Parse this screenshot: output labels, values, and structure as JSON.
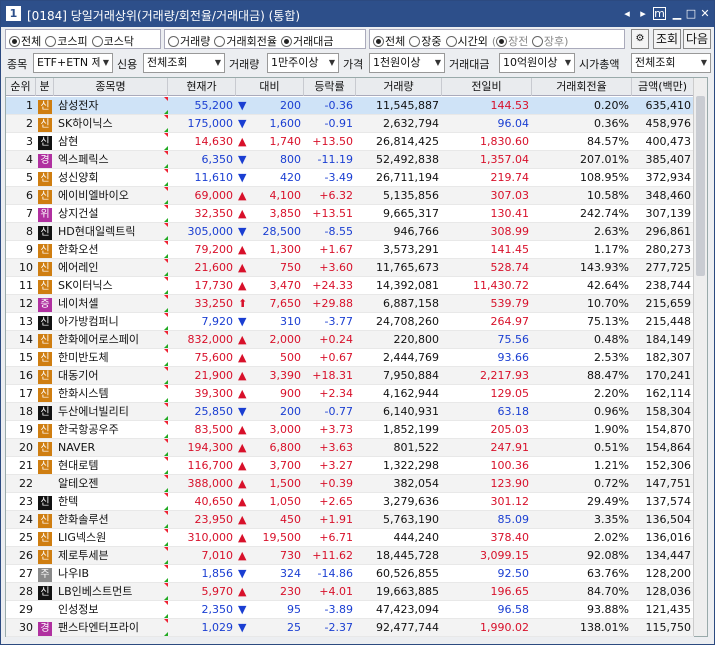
{
  "window": {
    "num": "1",
    "title": "[0184] 당일거래상위(거래량/회전율/거래대금) (통합)",
    "buttons": [
      "◂",
      "▸",
      "m",
      "▁",
      "□",
      "✕"
    ]
  },
  "bar1": {
    "market": [
      "전체",
      "코스피",
      "코스닥"
    ],
    "market_sel": 0,
    "sort": [
      "거래량",
      "거래회전율",
      "거래대금"
    ],
    "sort_sel": 2,
    "session": [
      "전체",
      "장중",
      "시간외"
    ],
    "session_sel": 0,
    "sub": [
      "장전",
      "장후"
    ],
    "sub_sel": 0,
    "btn_query": "조회",
    "btn_next": "다음"
  },
  "bar2": {
    "item_label": "종목",
    "item_val": "ETF+ETN 제",
    "credit_label": "신용",
    "credit_val": "전체조회",
    "vol_label": "거래량",
    "vol_val": "1만주이상",
    "price_label": "가격",
    "price_val": "1천원이상",
    "amt_label": "거래대금",
    "amt_val": "10억원이상",
    "cap_label": "시가총액",
    "cap_val": "전체조회"
  },
  "headers": [
    "순위",
    "분",
    "종목명",
    "현재가",
    "대비",
    "등락률",
    "거래량",
    "전일비",
    "거래회전율",
    "금액(백만)"
  ],
  "colors": {
    "badge_sin": "#cf7e11",
    "badge_gyeong": "#b030a0",
    "badge_ju": "#8a8a8a",
    "up": "#d8102a",
    "down": "#1a3ed2"
  },
  "rows": [
    {
      "rank": "1",
      "badge": "신",
      "name": "삼성전자",
      "price": "55,200",
      "arrow": "▼",
      "diff": "200",
      "rate": "-0.36",
      "volume": "11,545,887",
      "prev": "144.53",
      "turnover": "0.20%",
      "amount": "635,410",
      "dir": "dn",
      "sel": true
    },
    {
      "rank": "2",
      "badge": "신",
      "name": "SK하이닉스",
      "price": "175,000",
      "arrow": "▼",
      "diff": "1,600",
      "rate": "-0.91",
      "volume": "2,632,794",
      "prev": "96.04",
      "turnover": "0.36%",
      "amount": "458,976",
      "dir": "dn"
    },
    {
      "rank": "3",
      "badge": "신",
      "name": "삼현",
      "price": "14,630",
      "arrow": "▲",
      "diff": "1,740",
      "rate": "+13.50",
      "volume": "26,814,425",
      "prev": "1,830.60",
      "turnover": "84.57%",
      "amount": "400,473",
      "dir": "up"
    },
    {
      "rank": "4",
      "badge": "경",
      "name": "엑스페릭스",
      "price": "6,350",
      "arrow": "▼",
      "diff": "800",
      "rate": "-11.19",
      "volume": "52,492,838",
      "prev": "1,357.04",
      "turnover": "207.01%",
      "amount": "385,407",
      "dir": "dn"
    },
    {
      "rank": "5",
      "badge": "신",
      "name": "성신양회",
      "price": "11,610",
      "arrow": "▼",
      "diff": "420",
      "rate": "-3.49",
      "volume": "26,711,194",
      "prev": "219.74",
      "turnover": "108.95%",
      "amount": "372,934",
      "dir": "dn"
    },
    {
      "rank": "6",
      "badge": "신",
      "name": "에이비엘바이오",
      "price": "69,000",
      "arrow": "▲",
      "diff": "4,100",
      "rate": "+6.32",
      "volume": "5,135,856",
      "prev": "307.03",
      "turnover": "10.58%",
      "amount": "348,460",
      "dir": "up"
    },
    {
      "rank": "7",
      "badge": "위",
      "name": "상지건설",
      "price": "32,350",
      "arrow": "▲",
      "diff": "3,850",
      "rate": "+13.51",
      "volume": "9,665,317",
      "prev": "130.41",
      "turnover": "242.74%",
      "amount": "307,139",
      "dir": "up"
    },
    {
      "rank": "8",
      "badge": "신",
      "name": "HD현대일렉트릭",
      "price": "305,000",
      "arrow": "▼",
      "diff": "28,500",
      "rate": "-8.55",
      "volume": "946,766",
      "prev": "308.99",
      "turnover": "2.63%",
      "amount": "296,861",
      "dir": "dn"
    },
    {
      "rank": "9",
      "badge": "신",
      "name": "한화오션",
      "price": "79,200",
      "arrow": "▲",
      "diff": "1,300",
      "rate": "+1.67",
      "volume": "3,573,291",
      "prev": "141.45",
      "turnover": "1.17%",
      "amount": "280,273",
      "dir": "up"
    },
    {
      "rank": "10",
      "badge": "신",
      "name": "에어레인",
      "price": "21,600",
      "arrow": "▲",
      "diff": "750",
      "rate": "+3.60",
      "volume": "11,765,673",
      "prev": "528.74",
      "turnover": "143.93%",
      "amount": "277,725",
      "dir": "up"
    },
    {
      "rank": "11",
      "badge": "신",
      "name": "SK이터닉스",
      "price": "17,730",
      "arrow": "▲",
      "diff": "3,470",
      "rate": "+24.33",
      "volume": "14,392,081",
      "prev": "11,430.72",
      "turnover": "42.64%",
      "amount": "238,744",
      "dir": "up"
    },
    {
      "rank": "12",
      "badge": "증",
      "name": "네이처셀",
      "price": "33,250",
      "arrow": "⬆",
      "diff": "7,650",
      "rate": "+29.88",
      "volume": "6,887,158",
      "prev": "539.79",
      "turnover": "10.70%",
      "amount": "215,659",
      "dir": "up"
    },
    {
      "rank": "13",
      "badge": "신",
      "name": "아가방컴퍼니",
      "price": "7,920",
      "arrow": "▼",
      "diff": "310",
      "rate": "-3.77",
      "volume": "24,708,260",
      "prev": "264.97",
      "turnover": "75.13%",
      "amount": "215,448",
      "dir": "dn"
    },
    {
      "rank": "14",
      "badge": "신",
      "name": "한화에어로스페이",
      "price": "832,000",
      "arrow": "▲",
      "diff": "2,000",
      "rate": "+0.24",
      "volume": "220,800",
      "prev": "75.56",
      "turnover": "0.48%",
      "amount": "184,149",
      "dir": "up"
    },
    {
      "rank": "15",
      "badge": "신",
      "name": "한미반도체",
      "price": "75,600",
      "arrow": "▲",
      "diff": "500",
      "rate": "+0.67",
      "volume": "2,444,769",
      "prev": "93.66",
      "turnover": "2.53%",
      "amount": "182,307",
      "dir": "up"
    },
    {
      "rank": "16",
      "badge": "신",
      "name": "대동기어",
      "price": "21,900",
      "arrow": "▲",
      "diff": "3,390",
      "rate": "+18.31",
      "volume": "7,950,884",
      "prev": "2,217.93",
      "turnover": "88.47%",
      "amount": "170,241",
      "dir": "up"
    },
    {
      "rank": "17",
      "badge": "신",
      "name": "한화시스템",
      "price": "39,300",
      "arrow": "▲",
      "diff": "900",
      "rate": "+2.34",
      "volume": "4,162,944",
      "prev": "129.05",
      "turnover": "2.20%",
      "amount": "162,114",
      "dir": "up"
    },
    {
      "rank": "18",
      "badge": "신",
      "name": "두산에너빌리티",
      "price": "25,850",
      "arrow": "▼",
      "diff": "200",
      "rate": "-0.77",
      "volume": "6,140,931",
      "prev": "63.18",
      "turnover": "0.96%",
      "amount": "158,304",
      "dir": "dn"
    },
    {
      "rank": "19",
      "badge": "신",
      "name": "한국항공우주",
      "price": "83,500",
      "arrow": "▲",
      "diff": "3,000",
      "rate": "+3.73",
      "volume": "1,852,199",
      "prev": "205.03",
      "turnover": "1.90%",
      "amount": "154,870",
      "dir": "up"
    },
    {
      "rank": "20",
      "badge": "신",
      "name": "NAVER",
      "price": "194,300",
      "arrow": "▲",
      "diff": "6,800",
      "rate": "+3.63",
      "volume": "801,522",
      "prev": "247.91",
      "turnover": "0.51%",
      "amount": "154,864",
      "dir": "up"
    },
    {
      "rank": "21",
      "badge": "신",
      "name": "현대로템",
      "price": "116,700",
      "arrow": "▲",
      "diff": "3,700",
      "rate": "+3.27",
      "volume": "1,322,298",
      "prev": "100.36",
      "turnover": "1.21%",
      "amount": "152,306",
      "dir": "up"
    },
    {
      "rank": "22",
      "badge": "",
      "name": "알테오젠",
      "price": "388,000",
      "arrow": "▲",
      "diff": "1,500",
      "rate": "+0.39",
      "volume": "382,054",
      "prev": "123.90",
      "turnover": "0.72%",
      "amount": "147,751",
      "dir": "up"
    },
    {
      "rank": "23",
      "badge": "신",
      "name": "한텍",
      "price": "40,650",
      "arrow": "▲",
      "diff": "1,050",
      "rate": "+2.65",
      "volume": "3,279,636",
      "prev": "301.12",
      "turnover": "29.49%",
      "amount": "137,574",
      "dir": "up"
    },
    {
      "rank": "24",
      "badge": "신",
      "name": "한화솔루션",
      "price": "23,950",
      "arrow": "▲",
      "diff": "450",
      "rate": "+1.91",
      "volume": "5,763,190",
      "prev": "85.09",
      "turnover": "3.35%",
      "amount": "136,504",
      "dir": "up"
    },
    {
      "rank": "25",
      "badge": "신",
      "name": "LIG넥스원",
      "price": "310,000",
      "arrow": "▲",
      "diff": "19,500",
      "rate": "+6.71",
      "volume": "444,240",
      "prev": "378.40",
      "turnover": "2.02%",
      "amount": "136,016",
      "dir": "up"
    },
    {
      "rank": "26",
      "badge": "신",
      "name": "제로투세븐",
      "price": "7,010",
      "arrow": "▲",
      "diff": "730",
      "rate": "+11.62",
      "volume": "18,445,728",
      "prev": "3,099.15",
      "turnover": "92.08%",
      "amount": "134,447",
      "dir": "up"
    },
    {
      "rank": "27",
      "badge": "주",
      "name": "나우IB",
      "price": "1,856",
      "arrow": "▼",
      "diff": "324",
      "rate": "-14.86",
      "volume": "60,526,855",
      "prev": "92.50",
      "turnover": "63.76%",
      "amount": "128,200",
      "dir": "dn"
    },
    {
      "rank": "28",
      "badge": "신",
      "name": "LB인베스트먼트",
      "price": "5,970",
      "arrow": "▲",
      "diff": "230",
      "rate": "+4.01",
      "volume": "19,663,885",
      "prev": "196.65",
      "turnover": "84.70%",
      "amount": "128,036",
      "dir": "up"
    },
    {
      "rank": "29",
      "badge": "",
      "name": "인성정보",
      "price": "2,350",
      "arrow": "▼",
      "diff": "95",
      "rate": "-3.89",
      "volume": "47,423,094",
      "prev": "96.58",
      "turnover": "93.88%",
      "amount": "121,435",
      "dir": "dn"
    },
    {
      "rank": "30",
      "badge": "경",
      "name": "팬스타엔터프라이",
      "price": "1,029",
      "arrow": "▼",
      "diff": "25",
      "rate": "-2.37",
      "volume": "92,477,744",
      "prev": "1,990.02",
      "turnover": "138.01%",
      "amount": "115,750",
      "dir": "dn"
    }
  ]
}
